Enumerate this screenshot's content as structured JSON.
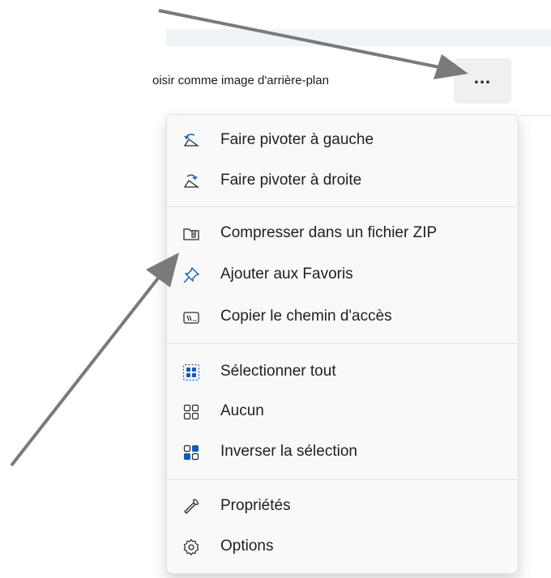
{
  "toolbar": {
    "wallpaper_label": "oisir comme image d'arrière-plan",
    "more_label": "..."
  },
  "menu": {
    "items": [
      {
        "label": "Faire pivoter à gauche",
        "icon": "rotate-left-icon"
      },
      {
        "label": "Faire pivoter à droite",
        "icon": "rotate-right-icon"
      },
      {
        "label": "Compresser dans un fichier ZIP",
        "icon": "zip-folder-icon"
      },
      {
        "label": "Ajouter aux Favoris",
        "icon": "pin-icon"
      },
      {
        "label": "Copier le chemin d'accès",
        "icon": "copy-path-icon"
      },
      {
        "label": "Sélectionner tout",
        "icon": "select-all-icon"
      },
      {
        "label": "Aucun",
        "icon": "select-none-icon"
      },
      {
        "label": "Inverser la sélection",
        "icon": "invert-selection-icon"
      },
      {
        "label": "Propriétés",
        "icon": "wrench-icon"
      },
      {
        "label": "Options",
        "icon": "gear-icon"
      }
    ]
  },
  "colors": {
    "accent": "#0a5cc4",
    "arrow": "#7a7a7a",
    "menu_bg": "#f9f9f9"
  }
}
